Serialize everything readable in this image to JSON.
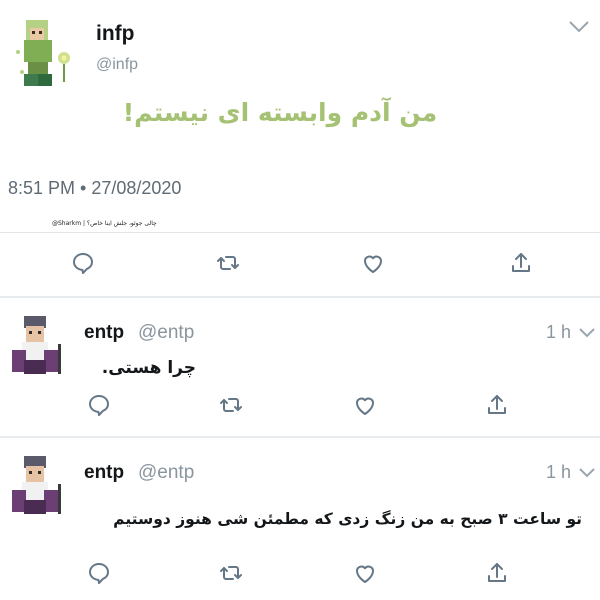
{
  "main_tweet": {
    "author_name": "infp",
    "author_handle": "@infp",
    "text": "من آدم وابسته ای نیستم!",
    "timestamp": "8:51 PM • 27/08/2020",
    "watermark": "@Sharkm | چالی جوئو، جلش اینا خاص؟",
    "accent_color": "#a5c274"
  },
  "replies": [
    {
      "author_name": "entp",
      "author_handle": "@entp",
      "time": "1 h",
      "text": "چرا هستی."
    },
    {
      "author_name": "entp",
      "author_handle": "@entp",
      "time": "1 h",
      "text": "تو ساعت ۳ صبح به من زنگ زدی که مطمئن شی هنوز دوستیم"
    }
  ],
  "icons": {
    "reply": "reply-icon",
    "retweet": "retweet-icon",
    "like": "like-icon",
    "share": "share-icon",
    "more": "chevron-down-icon"
  }
}
